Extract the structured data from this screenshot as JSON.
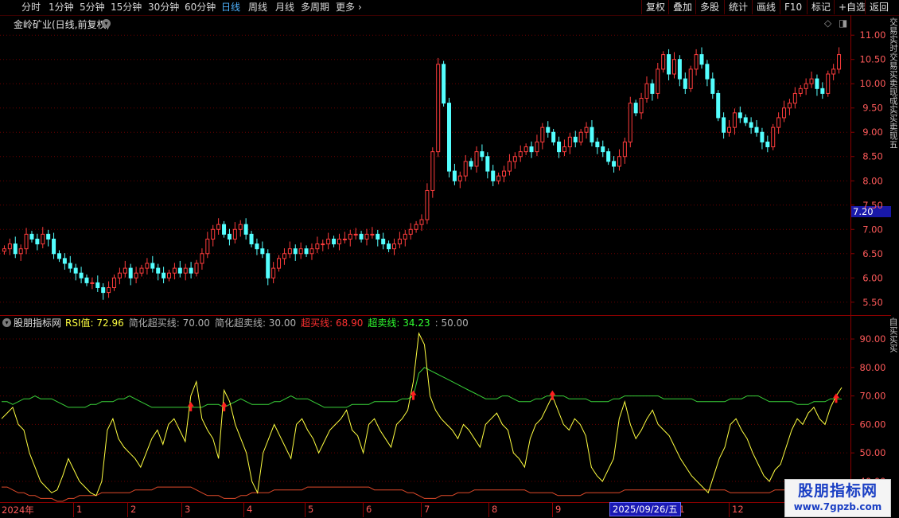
{
  "toolbar": {
    "periods": [
      "分时",
      "1分钟",
      "5分钟",
      "15分钟",
      "30分钟",
      "60分钟",
      "日线",
      "周线",
      "月线",
      "多周期",
      "更多"
    ],
    "active_period": "日线",
    "right_buttons": [
      "复权",
      "叠加",
      "多股",
      "统计",
      "画线",
      "F10",
      "标记",
      "+自选",
      "返回"
    ]
  },
  "price_panel": {
    "title": "金岭矿业(日线,前复权)",
    "price_marker": "7.20",
    "y_ticks": [
      "11.00",
      "10.50",
      "10.00",
      "9.50",
      "9.00",
      "8.50",
      "8.00",
      "7.50",
      "7.00",
      "6.50",
      "6.00",
      "5.50"
    ],
    "side_text": "交易实时交易买卖现成实买卖现五"
  },
  "indicator_panel": {
    "name": "股朋指标网",
    "items": [
      {
        "label": "RSI值:",
        "value": "72.96",
        "color": "#ffff40"
      },
      {
        "label": "简化超买线:",
        "value": "70.00",
        "color": "#b0b0b0"
      },
      {
        "label": "简化超卖线:",
        "value": "30.00",
        "color": "#b0b0b0"
      },
      {
        "label": "超买线:",
        "value": "68.90",
        "color": "#ff3030"
      },
      {
        "label": "超卖线:",
        "value": "34.23",
        "color": "#30ff30"
      },
      {
        "label": ":",
        "value": "50.00",
        "color": "#b0b0b0"
      }
    ],
    "y_ticks": [
      "90.00",
      "80.00",
      "70.00",
      "60.00",
      "50.00",
      "40.00"
    ],
    "side_text": "自买买买"
  },
  "x_axis": {
    "ticks": [
      "2024年",
      "1",
      "2",
      "3",
      "4",
      "5",
      "6",
      "7",
      "8",
      "9",
      "10",
      "11",
      "12"
    ],
    "date_pill": "2025/09/26/五"
  },
  "watermark": {
    "title": "股朋指标网",
    "url": "www.7gpzb.com"
  },
  "chart_data": {
    "type": "candlestick+line",
    "price": {
      "ylim": [
        5.3,
        11.2
      ],
      "closes": [
        6.6,
        6.7,
        6.5,
        6.6,
        6.9,
        6.8,
        6.7,
        6.9,
        6.8,
        6.5,
        6.4,
        6.3,
        6.2,
        6.1,
        6.0,
        5.9,
        5.9,
        5.8,
        5.7,
        5.8,
        6.0,
        6.1,
        6.2,
        6.0,
        6.1,
        6.2,
        6.3,
        6.2,
        6.1,
        6.0,
        6.1,
        6.2,
        6.1,
        6.2,
        6.1,
        6.3,
        6.5,
        6.8,
        7.0,
        7.1,
        6.9,
        6.8,
        7.0,
        7.1,
        6.9,
        6.7,
        6.6,
        6.5,
        6.0,
        6.2,
        6.4,
        6.5,
        6.6,
        6.5,
        6.6,
        6.5,
        6.6,
        6.7,
        6.7,
        6.8,
        6.7,
        6.8,
        6.8,
        6.9,
        6.9,
        6.8,
        6.9,
        6.9,
        6.8,
        6.7,
        6.6,
        6.7,
        6.8,
        6.9,
        7.0,
        7.1,
        7.2,
        7.8,
        8.6,
        10.4,
        9.6,
        8.2,
        8.0,
        8.1,
        8.4,
        8.3,
        8.6,
        8.5,
        8.2,
        8.0,
        8.1,
        8.2,
        8.4,
        8.5,
        8.6,
        8.7,
        8.6,
        8.8,
        9.1,
        9.0,
        8.8,
        8.6,
        8.7,
        8.9,
        8.8,
        9.0,
        9.1,
        8.8,
        8.7,
        8.6,
        8.4,
        8.3,
        8.5,
        8.8,
        9.6,
        9.4,
        9.7,
        10.0,
        9.8,
        10.3,
        10.6,
        10.2,
        10.5,
        10.1,
        9.9,
        10.3,
        10.6,
        10.4,
        10.1,
        9.8,
        9.3,
        9.0,
        9.1,
        9.4,
        9.3,
        9.2,
        9.1,
        9.0,
        8.8,
        8.7,
        9.1,
        9.3,
        9.5,
        9.6,
        9.8,
        9.9,
        10.0,
        10.1,
        9.9,
        9.8,
        10.2,
        10.3,
        10.6
      ],
      "gridlines": [
        11.0,
        10.5,
        10.0,
        9.5,
        9.0,
        8.5,
        8.0,
        7.5,
        7.0,
        6.5,
        6.0,
        5.5
      ]
    },
    "rsi": {
      "ylim": [
        33,
        97
      ],
      "gridlines": [
        90,
        80,
        70,
        60,
        50,
        40
      ],
      "rsi_series": "RSI值",
      "overbought_series": "超买线",
      "oversold_series": "超卖线",
      "rsi": [
        62,
        64,
        66,
        60,
        58,
        50,
        45,
        40,
        38,
        36,
        37,
        42,
        48,
        44,
        40,
        38,
        36,
        35,
        40,
        58,
        62,
        55,
        52,
        50,
        48,
        45,
        50,
        55,
        58,
        53,
        60,
        62,
        58,
        54,
        70,
        75,
        62,
        58,
        55,
        48,
        72,
        68,
        60,
        55,
        50,
        40,
        36,
        50,
        55,
        60,
        56,
        52,
        48,
        60,
        62,
        58,
        55,
        50,
        54,
        58,
        60,
        62,
        65,
        58,
        56,
        50,
        60,
        62,
        58,
        55,
        52,
        60,
        62,
        65,
        75,
        92,
        88,
        70,
        65,
        62,
        60,
        58,
        55,
        60,
        58,
        55,
        52,
        60,
        62,
        64,
        60,
        58,
        50,
        48,
        45,
        55,
        60,
        62,
        66,
        70,
        65,
        60,
        58,
        62,
        60,
        56,
        45,
        42,
        40,
        44,
        48,
        62,
        68,
        60,
        55,
        58,
        62,
        65,
        60,
        58,
        56,
        52,
        48,
        45,
        42,
        40,
        38,
        36,
        42,
        48,
        52,
        60,
        62,
        58,
        55,
        50,
        46,
        42,
        40,
        44,
        46,
        52,
        58,
        62,
        60,
        64,
        66,
        62,
        60,
        66,
        70,
        72.96
      ],
      "overbought": [
        68,
        68,
        67,
        68,
        69,
        69,
        70,
        69,
        69,
        69,
        68,
        67,
        66,
        66,
        66,
        66,
        67,
        67,
        68,
        68,
        68,
        69,
        69,
        70,
        69,
        68,
        67,
        66,
        66,
        66,
        66,
        66,
        66,
        66,
        66,
        66,
        66,
        67,
        67,
        67,
        66,
        67,
        68,
        69,
        68,
        67,
        67,
        67,
        67,
        68,
        68,
        69,
        70,
        69,
        69,
        69,
        68,
        67,
        66,
        66,
        66,
        66,
        66,
        67,
        67,
        67,
        67,
        68,
        68,
        68,
        68,
        68,
        69,
        69,
        70,
        78,
        80,
        79,
        78,
        77,
        76,
        75,
        74,
        73,
        72,
        71,
        70,
        69,
        69,
        69,
        70,
        70,
        69,
        68,
        68,
        68,
        69,
        69,
        70,
        70,
        70,
        70,
        69,
        69,
        69,
        69,
        68,
        68,
        68,
        68,
        69,
        69,
        70,
        70,
        70,
        70,
        70,
        70,
        70,
        69,
        69,
        69,
        69,
        69,
        69,
        68,
        68,
        68,
        68,
        68,
        68,
        69,
        69,
        69,
        70,
        70,
        70,
        69,
        68,
        68,
        68,
        68,
        68,
        67,
        67,
        67,
        68,
        68,
        68,
        69,
        69,
        68.9
      ],
      "oversold": [
        38,
        38,
        37,
        36,
        36,
        35,
        35,
        34,
        34,
        34,
        33,
        33,
        34,
        34,
        35,
        35,
        35,
        35,
        36,
        36,
        36,
        36,
        36,
        36,
        37,
        37,
        37,
        37,
        38,
        38,
        38,
        38,
        38,
        38,
        38,
        37,
        36,
        35,
        35,
        35,
        34,
        34,
        34,
        35,
        35,
        36,
        36,
        36,
        36,
        37,
        37,
        37,
        37,
        37,
        37,
        38,
        38,
        38,
        38,
        38,
        38,
        38,
        38,
        38,
        38,
        38,
        38,
        37,
        37,
        37,
        37,
        37,
        37,
        36,
        36,
        35,
        34,
        34,
        34,
        35,
        35,
        35,
        36,
        36,
        36,
        37,
        37,
        37,
        37,
        37,
        37,
        37,
        37,
        37,
        37,
        36,
        36,
        36,
        36,
        36,
        35,
        35,
        35,
        35,
        35,
        36,
        36,
        36,
        36,
        36,
        36,
        36,
        37,
        37,
        37,
        37,
        37,
        37,
        37,
        37,
        37,
        37,
        37,
        37,
        37,
        37,
        37,
        37,
        37,
        37,
        37,
        36,
        36,
        36,
        36,
        36,
        36,
        36,
        36,
        37,
        37,
        37,
        37,
        37,
        37,
        37,
        37,
        37,
        37,
        37,
        37,
        34.23
      ]
    }
  }
}
